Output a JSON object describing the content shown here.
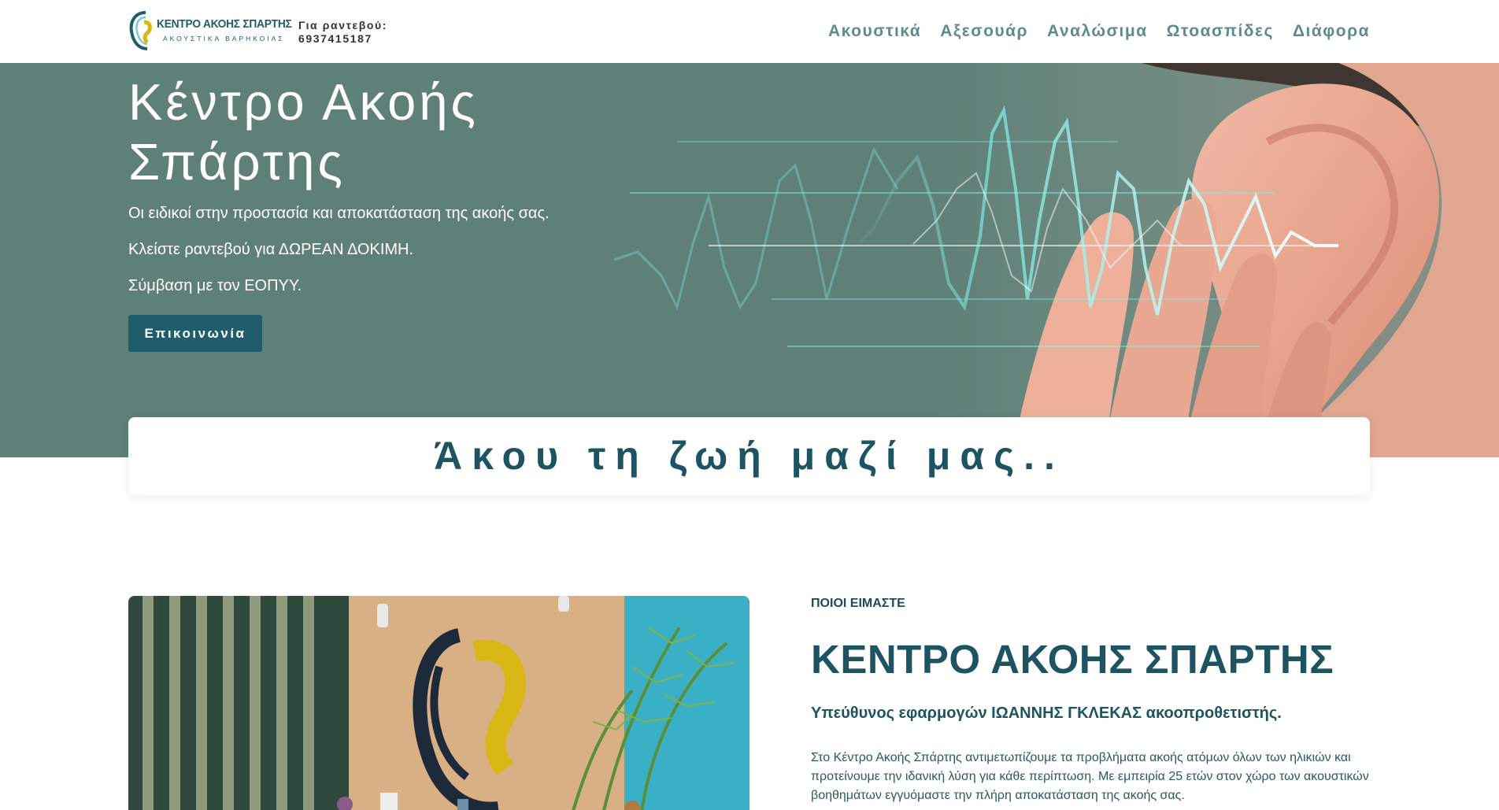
{
  "header": {
    "logo_title": "ΚΕΝΤΡΟ ΑΚΟΗΣ ΣΠΑΡΤΗΣ",
    "logo_subtitle": "ΑΚΟΥΣΤΙΚΑ ΒΑΡΗΚΟΙΑΣ",
    "appointment_label": "Για ραντεβού:",
    "appointment_phone": "6937415187",
    "nav": [
      "Ακουστικά",
      "Αξεσουάρ",
      "Αναλώσιμα",
      "Ωτοασπίδες",
      "Διάφορα"
    ]
  },
  "hero": {
    "title_line1": "Κέντρο Ακοής",
    "title_line2": "Σπάρτης",
    "line1": "Οι ειδικοί στην προστασία και αποκατάσταση της ακοής σας.",
    "line2": "Κλείστε ραντεβού για ΔΩΡΕΑΝ ΔΟΚΙΜΗ.",
    "line3": "Σύμβαση με τον ΕΟΠΥΥ.",
    "button": "Επικοινωνία"
  },
  "tagline": "Άκου τη ζωή μαζί μας..",
  "about": {
    "eyebrow": "ΠΟΙΟΙ ΕΙΜΑΣΤΕ",
    "title": "ΚΕΝΤΡΟ ΑΚΟΗΣ ΣΠΑΡΤΗΣ",
    "subtitle": "Υπεύθυνος εφαρμογών ΙΩΑΝΝΗΣ ΓΚΛΕΚΑΣ ακοοπροθετιστής.",
    "body": "Στο Κέντρο Ακοής Σπάρτης αντιμετωπίζουμε τα προβλήματα ακοής ατόμων όλων των ηλικιών και προτείνουμε την ιδανική λύση για κάθε περίπτωση. Με εμπειρία 25 ετών στον χώρο των ακουστικών βοηθημάτων εγγυόμαστε την πλήρη αποκατάσταση της ακοής σας."
  },
  "colors": {
    "brand": "#1f5d6c",
    "hero_bg": "#5f8077",
    "nav_text": "#5e8a91",
    "wave": "#7ff0e8"
  }
}
